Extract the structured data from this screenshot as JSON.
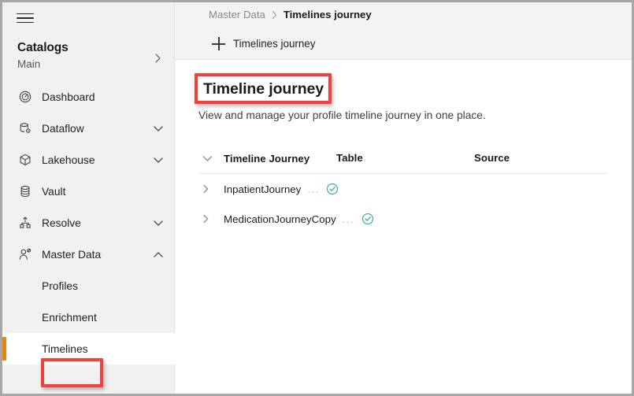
{
  "theme": {
    "accent_orange": "#e8830c",
    "sidebar_bg": "#f1f1f1",
    "topbar_bg": "#f3f3f3",
    "status_teal": "#2aa9a0",
    "annotation_red": "#f2403c",
    "text_primary": "#1b1b1b",
    "text_muted": "#8a8a8a"
  },
  "sidebar": {
    "menu_icon": "hamburger-icon",
    "catalogs": {
      "title": "Catalogs",
      "subtitle": "Main",
      "chevron": "chevron-right-icon"
    },
    "items": [
      {
        "label": "Dashboard",
        "icon": "gauge-icon",
        "chevron": "",
        "expanded": false
      },
      {
        "label": "Dataflow",
        "icon": "database-gear-icon",
        "chevron": "chevron-down-icon",
        "expanded": false
      },
      {
        "label": "Lakehouse",
        "icon": "cube-icon",
        "chevron": "chevron-down-icon",
        "expanded": false
      },
      {
        "label": "Vault",
        "icon": "database-icon",
        "chevron": "",
        "expanded": false
      },
      {
        "label": "Resolve",
        "icon": "merge-nodes-icon",
        "chevron": "chevron-down-icon",
        "expanded": false
      },
      {
        "label": "Master Data",
        "icon": "user-icon",
        "chevron": "chevron-up-icon",
        "expanded": true
      }
    ],
    "sub_items": [
      {
        "label": "Profiles",
        "selected": false
      },
      {
        "label": "Enrichment",
        "selected": false
      },
      {
        "label": "Timelines",
        "selected": true
      }
    ]
  },
  "topbar": {
    "breadcrumb": {
      "parent": "Master Data",
      "separator": "chevron-right-icon",
      "current": "Timelines journey"
    },
    "tab": {
      "add_icon": "plus-icon",
      "label": "Timelines journey"
    }
  },
  "page": {
    "title": "Timeline journey",
    "subtitle": "View and manage your profile timeline journey in one place."
  },
  "table": {
    "header_expander_icon": "chevron-down-icon",
    "columns": [
      "Timeline Journey",
      "Table",
      "Source"
    ],
    "rows": [
      {
        "expander_icon": "chevron-right-icon",
        "name": "InpatientJourney",
        "overflow_menu": "...",
        "status_icon": "check-circle-icon",
        "table": "",
        "source": ""
      },
      {
        "expander_icon": "chevron-right-icon",
        "name": "MedicationJourneyCopy",
        "overflow_menu": "...",
        "status_icon": "check-circle-icon",
        "table": "",
        "source": ""
      }
    ]
  },
  "annotations": [
    {
      "name": "annotation-box-page-title",
      "target": "Timeline journey"
    },
    {
      "name": "annotation-box-timelines-nav",
      "target": "Timelines"
    }
  ]
}
